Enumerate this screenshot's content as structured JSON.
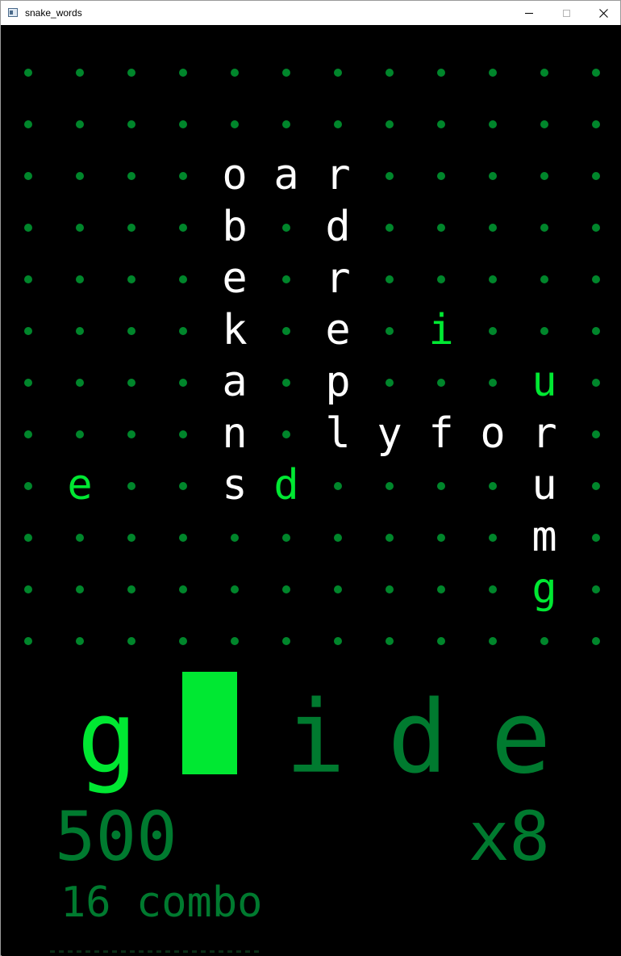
{
  "window": {
    "title": "snake_words",
    "minimize_glyph": "",
    "maximize_glyph": "",
    "close_glyph": ""
  },
  "colors": {
    "background": "#000000",
    "dot": "#00862b",
    "placed_letter": "#ffffff",
    "pickup_letter": "#00e832",
    "typed_letter": "#00e832",
    "pending_letter": "#007a2f",
    "cursor": "#00e832",
    "score": "#007a2f"
  },
  "grid": {
    "columns": 12,
    "rows": 12,
    "letters": [
      {
        "row": 2,
        "col": 4,
        "char": "o",
        "kind": "placed"
      },
      {
        "row": 2,
        "col": 5,
        "char": "a",
        "kind": "placed"
      },
      {
        "row": 2,
        "col": 6,
        "char": "r",
        "kind": "placed"
      },
      {
        "row": 3,
        "col": 4,
        "char": "b",
        "kind": "placed"
      },
      {
        "row": 3,
        "col": 6,
        "char": "d",
        "kind": "placed"
      },
      {
        "row": 4,
        "col": 4,
        "char": "e",
        "kind": "placed"
      },
      {
        "row": 4,
        "col": 6,
        "char": "r",
        "kind": "placed"
      },
      {
        "row": 5,
        "col": 4,
        "char": "k",
        "kind": "placed"
      },
      {
        "row": 5,
        "col": 6,
        "char": "e",
        "kind": "placed"
      },
      {
        "row": 5,
        "col": 8,
        "char": "i",
        "kind": "pickup"
      },
      {
        "row": 6,
        "col": 4,
        "char": "a",
        "kind": "placed"
      },
      {
        "row": 6,
        "col": 6,
        "char": "p",
        "kind": "placed"
      },
      {
        "row": 6,
        "col": 10,
        "char": "u",
        "kind": "pickup"
      },
      {
        "row": 7,
        "col": 4,
        "char": "n",
        "kind": "placed"
      },
      {
        "row": 7,
        "col": 6,
        "char": "l",
        "kind": "placed"
      },
      {
        "row": 7,
        "col": 7,
        "char": "y",
        "kind": "placed"
      },
      {
        "row": 7,
        "col": 8,
        "char": "f",
        "kind": "placed"
      },
      {
        "row": 7,
        "col": 9,
        "char": "o",
        "kind": "placed"
      },
      {
        "row": 7,
        "col": 10,
        "char": "r",
        "kind": "placed"
      },
      {
        "row": 8,
        "col": 1,
        "char": "e",
        "kind": "pickup"
      },
      {
        "row": 8,
        "col": 4,
        "char": "s",
        "kind": "placed"
      },
      {
        "row": 8,
        "col": 5,
        "char": "d",
        "kind": "pickup"
      },
      {
        "row": 8,
        "col": 10,
        "char": "u",
        "kind": "placed"
      },
      {
        "row": 9,
        "col": 10,
        "char": "m",
        "kind": "placed"
      },
      {
        "row": 10,
        "col": 10,
        "char": "g",
        "kind": "pickup"
      }
    ]
  },
  "word_input": {
    "typed": [
      "g"
    ],
    "cursor_index": 1,
    "pending": [
      "i",
      "d",
      "e"
    ]
  },
  "score": "500",
  "multiplier": "x8",
  "combo": "16 combo"
}
